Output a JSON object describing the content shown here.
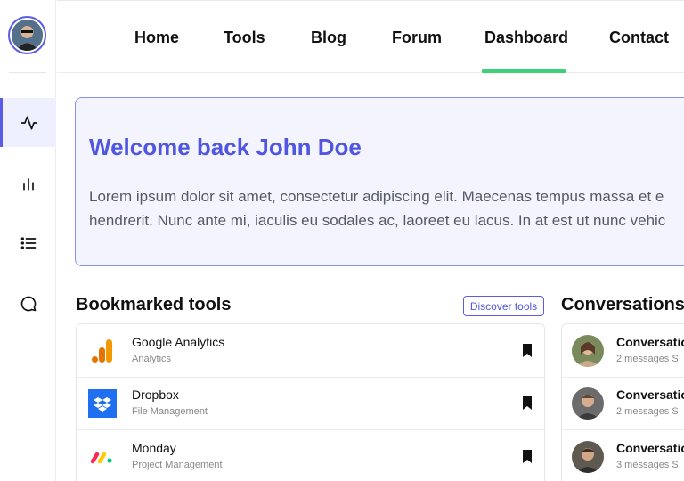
{
  "sidebar": {
    "avatar_icon": "user-avatar",
    "items": [
      {
        "icon": "activity-icon",
        "active": true
      },
      {
        "icon": "bar-chart-icon",
        "active": false
      },
      {
        "icon": "list-icon",
        "active": false
      },
      {
        "icon": "chat-bubble-icon",
        "active": false
      }
    ]
  },
  "nav": {
    "logo_icon": "moon-logo",
    "links": [
      "Home",
      "Tools",
      "Blog",
      "Forum",
      "Dashboard",
      "Contact"
    ],
    "active": "Dashboard"
  },
  "welcome": {
    "title": "Welcome back John Doe",
    "line1": "Lorem ipsum dolor sit amet, consectetur adipiscing elit. Maecenas tempus massa et e",
    "line2": "hendrerit. Nunc ante mi, iaculis eu sodales ac, laoreet eu lacus. In at est ut nunc vehic"
  },
  "bookmarks": {
    "title": "Bookmarked tools",
    "discover_label": "Discover tools",
    "tools": [
      {
        "name": "Google Analytics",
        "category": "Analytics",
        "icon": "google-analytics-icon"
      },
      {
        "name": "Dropbox",
        "category": "File Management",
        "icon": "dropbox-icon"
      },
      {
        "name": "Monday",
        "category": "Project Management",
        "icon": "monday-icon"
      }
    ]
  },
  "conversations": {
    "title": "Conversations",
    "items": [
      {
        "title": "Conversatio",
        "meta": "2 messages   S"
      },
      {
        "title": "Conversatio",
        "meta": "2 messages   S"
      },
      {
        "title": "Conversatio",
        "meta": "3 messages   S"
      }
    ]
  },
  "colors": {
    "accent": "#5b5ce6",
    "welcome_title": "#4f56e0",
    "nav_active_underline": "#3dd17a"
  }
}
